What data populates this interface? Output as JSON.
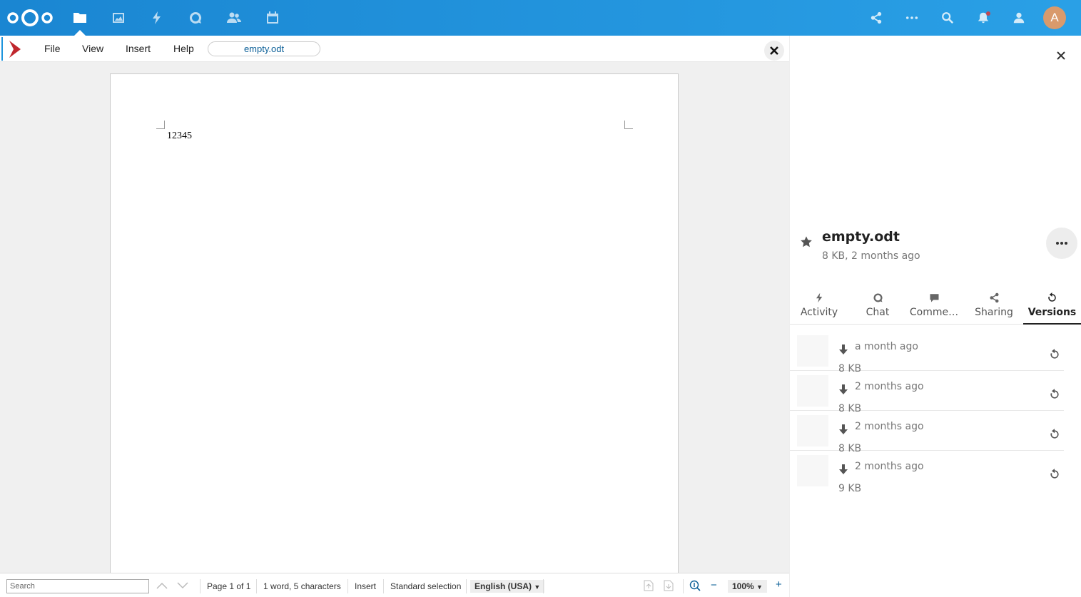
{
  "topbar": {
    "apps": [
      {
        "name": "files-icon"
      },
      {
        "name": "photos-icon"
      },
      {
        "name": "activity-icon"
      },
      {
        "name": "talk-icon"
      },
      {
        "name": "contacts-icon"
      },
      {
        "name": "calendar-icon"
      }
    ],
    "avatar_letter": "A"
  },
  "menubar": {
    "items": [
      "File",
      "View",
      "Insert",
      "Help"
    ],
    "document_name": "empty.odt"
  },
  "document": {
    "text": "12345"
  },
  "statusbar": {
    "search_placeholder": "Search",
    "page": "Page 1 of 1",
    "word_count": "1 word, 5 characters",
    "mode": "Insert",
    "selection": "Standard selection",
    "language": "English (USA)",
    "zoom": "100%",
    "zoom_minus": "−",
    "zoom_plus": "+"
  },
  "sidebar": {
    "file_title": "empty.odt",
    "file_subtitle": "8 KB, 2 months ago",
    "tabs": [
      {
        "label": "Activity",
        "icon": "activity-icon"
      },
      {
        "label": "Chat",
        "icon": "chat-icon"
      },
      {
        "label": "Comme…",
        "icon": "comments-icon"
      },
      {
        "label": "Sharing",
        "icon": "share-icon"
      },
      {
        "label": "Versions",
        "icon": "history-icon",
        "active": true
      }
    ],
    "versions": [
      {
        "date": "a month ago",
        "size": "8 KB"
      },
      {
        "date": "2 months ago",
        "size": "8 KB"
      },
      {
        "date": "2 months ago",
        "size": "8 KB"
      },
      {
        "date": "2 months ago",
        "size": "9 KB"
      }
    ]
  },
  "colors": {
    "header": "#1e95dd",
    "accent": "#0b5f97",
    "collabora_red": "#c0272d"
  }
}
